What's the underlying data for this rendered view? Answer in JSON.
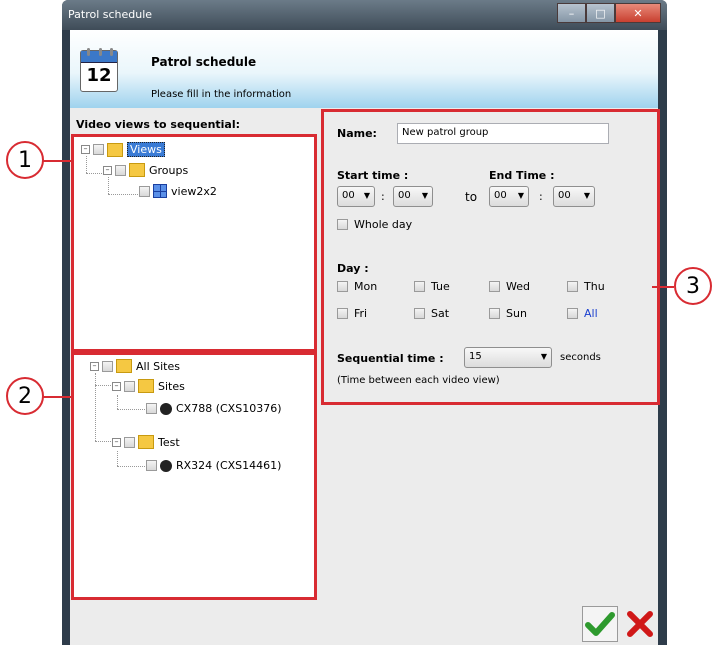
{
  "window": {
    "title": "Patrol schedule"
  },
  "header": {
    "title": "Patrol schedule",
    "subtitle": "Please fill in the information",
    "calendar_day": "12"
  },
  "views_section": {
    "label": "Video views to sequential:"
  },
  "views_tree": [
    {
      "label": "Views"
    },
    {
      "label": "Groups"
    },
    {
      "label": "view2x2"
    }
  ],
  "sites_tree": [
    {
      "label": "All Sites"
    },
    {
      "label": "Sites"
    },
    {
      "label": "CX788 (CXS10376)"
    },
    {
      "label": "Test"
    },
    {
      "label": "RX324 (CXS14461)"
    }
  ],
  "form": {
    "name_label": "Name:",
    "name_value": "New patrol group",
    "start_label": "Start time :",
    "end_label": "End Time :",
    "start_hour": "00",
    "start_min": "00",
    "end_hour": "00",
    "end_min": "00",
    "colon": ":",
    "to": "to",
    "whole_day": "Whole day",
    "day_label": "Day :",
    "days": [
      "Mon",
      "Tue",
      "Wed",
      "Thu",
      "Fri",
      "Sat",
      "Sun",
      "All"
    ],
    "seq_label": "Sequential time :",
    "seq_value": "15",
    "seconds": "seconds",
    "seq_hint": "(Time between each video view)"
  },
  "callouts": [
    "1",
    "2",
    "3"
  ],
  "colors": {
    "highlight": "#d82b32",
    "accent": "#3a7bd5",
    "ok": "#2e9a2e",
    "cancel": "#d01818"
  },
  "icons": [
    "calendar-icon",
    "folder-icon",
    "view-grid-icon",
    "camera-icon",
    "check-icon",
    "x-icon"
  ]
}
